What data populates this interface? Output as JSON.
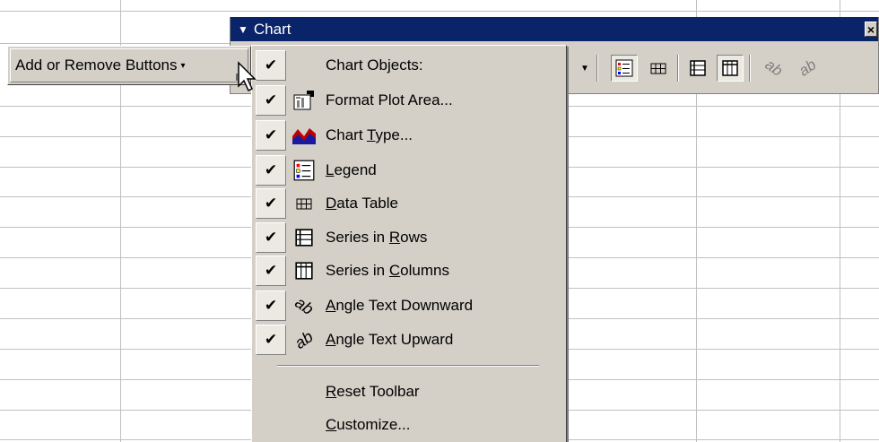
{
  "window": {
    "title": "Chart",
    "close_glyph": "×"
  },
  "add_remove": {
    "label": "Add or Remove Buttons",
    "arrow": "▾"
  },
  "menu": {
    "header": "Chart Objects:",
    "items": [
      {
        "check": "✔",
        "pre": "",
        "u": "",
        "post": "Format Plot Area...",
        "icon": "format-plot-area-icon"
      },
      {
        "check": "✔",
        "pre": "Chart ",
        "u": "T",
        "post": "ype...",
        "icon": "chart-type-icon"
      },
      {
        "check": "✔",
        "pre": "",
        "u": "L",
        "post": "egend",
        "icon": "legend-icon"
      },
      {
        "check": "✔",
        "pre": "",
        "u": "D",
        "post": "ata Table",
        "icon": "data-table-icon"
      },
      {
        "check": "✔",
        "pre": "Series in ",
        "u": "R",
        "post": "ows",
        "icon": "series-in-rows-icon"
      },
      {
        "check": "✔",
        "pre": "Series in ",
        "u": "C",
        "post": "olumns",
        "icon": "series-in-columns-icon"
      },
      {
        "check": "✔",
        "pre": "",
        "u": "A",
        "post": "ngle Text Downward",
        "icon": "angle-text-downward-icon"
      },
      {
        "check": "✔",
        "pre": "",
        "u": "A",
        "post": "ngle Text Upward",
        "icon": "angle-text-upward-icon"
      }
    ],
    "header_check": "✔",
    "reset": {
      "pre": "",
      "u": "R",
      "post": "eset Toolbar"
    },
    "customize": {
      "pre": "",
      "u": "C",
      "post": "ustomize..."
    }
  },
  "colors": {
    "title_bar": "#0a246a",
    "face": "#d4d0c8",
    "grid": "#c0c0c0"
  }
}
